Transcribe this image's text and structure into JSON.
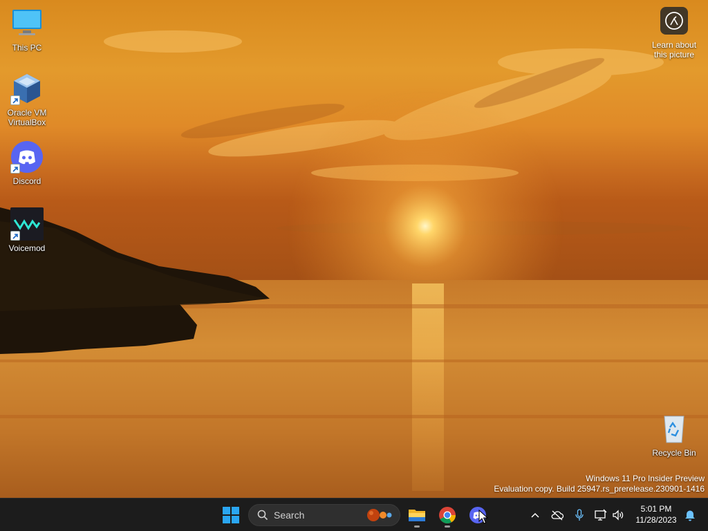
{
  "desktop": {
    "icons": [
      {
        "label": "This PC",
        "icon": "monitor-icon"
      },
      {
        "label": "Oracle VM VirtualBox",
        "icon": "virtualbox-icon"
      },
      {
        "label": "Discord",
        "icon": "discord-icon"
      },
      {
        "label": "Voicemod",
        "icon": "voicemod-icon"
      }
    ],
    "recycle_bin": {
      "label": "Recycle Bin",
      "icon": "recycle-bin-icon"
    },
    "learn_picture": {
      "label": "Learn about this picture",
      "icon": "camera-icon"
    },
    "watermark": {
      "line1": "Windows 11 Pro Insider Preview",
      "line2": "Evaluation copy. Build 25947.rs_prerelease.230901-1416"
    }
  },
  "taskbar": {
    "search": {
      "placeholder": "Search"
    },
    "apps": [
      "start-icon",
      "file-explorer-icon",
      "chrome-icon",
      "discord-icon"
    ],
    "tray": [
      "chevron-up-icon",
      "cloud-offline-icon",
      "microphone-icon",
      "network-icon",
      "volume-icon"
    ],
    "clock": {
      "time": "5:01 PM",
      "date": "11/28/2023"
    },
    "notification_icon": "bell-icon"
  },
  "colors": {
    "taskbar_bg": "#1c1c1c",
    "discord": "#5865F2",
    "windows_blue": "#2aa6f2",
    "sky_gold": "#f0a22c"
  }
}
